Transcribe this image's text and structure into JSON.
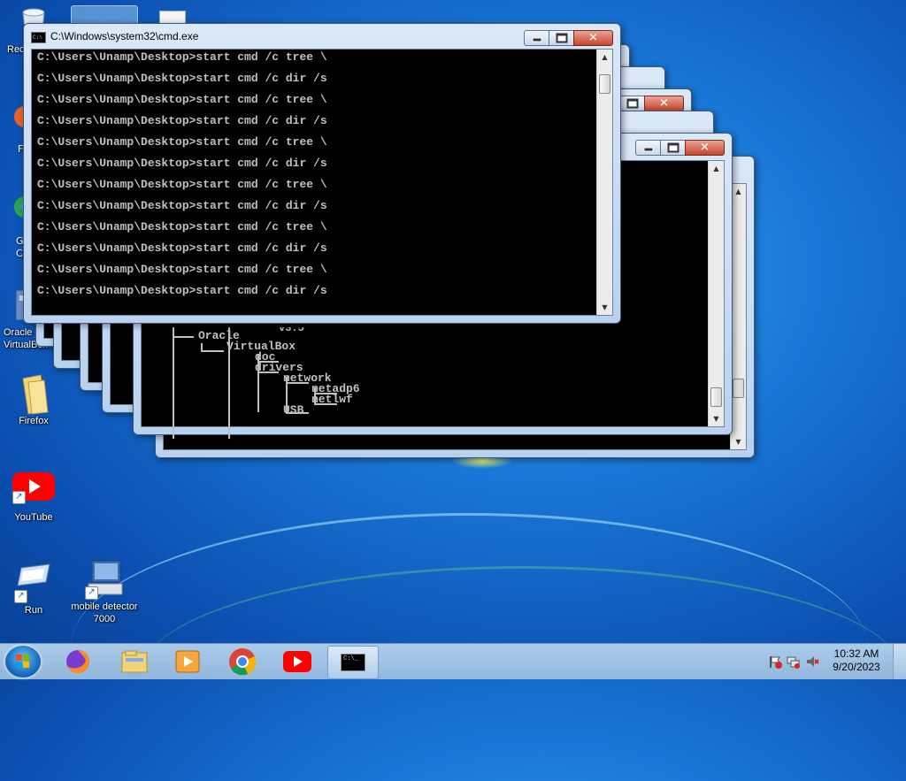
{
  "desktop": {
    "icons": [
      {
        "label": "Rec",
        "name": "recycle-bin"
      },
      {
        "label": "Oracle VirtualBox",
        "name": "virtualbox"
      },
      {
        "label": "Firefox",
        "name": "firefox-folder"
      },
      {
        "label": "YouTube",
        "name": "youtube"
      },
      {
        "label": "Run",
        "name": "run"
      },
      {
        "label": "mobile detector 7000",
        "name": "mobile-detector"
      }
    ],
    "partial_labels": [
      "F",
      "G",
      "C"
    ]
  },
  "front_window": {
    "title": "C:\\Windows\\system32\\cmd.exe",
    "lines": [
      "C:\\Users\\Unamp\\Desktop>start cmd /c tree \\",
      "C:\\Users\\Unamp\\Desktop>start cmd /c dir /s",
      "C:\\Users\\Unamp\\Desktop>start cmd /c tree \\",
      "C:\\Users\\Unamp\\Desktop>start cmd /c dir /s",
      "C:\\Users\\Unamp\\Desktop>start cmd /c tree \\",
      "C:\\Users\\Unamp\\Desktop>start cmd /c dir /s",
      "C:\\Users\\Unamp\\Desktop>start cmd /c tree \\",
      "C:\\Users\\Unamp\\Desktop>start cmd /c dir /s",
      "C:\\Users\\Unamp\\Desktop>start cmd /c tree \\",
      "C:\\Users\\Unamp\\Desktop>start cmd /c dir /s",
      "C:\\Users\\Unamp\\Desktop>start cmd /c tree \\",
      "C:\\Users\\Unamp\\Desktop>start cmd /c dir /s"
    ]
  },
  "tree_window": {
    "partial_top": "v3.5",
    "items": {
      "oracle": "Oracle",
      "virtualbox": "VirtualBox",
      "doc": "doc",
      "drivers": "drivers",
      "network": "network",
      "netadp6": "netadp6",
      "netlwf": "netlwf",
      "usb": "USB"
    }
  },
  "taskbar": {
    "items": [
      "firefox",
      "explorer",
      "media-player",
      "chrome",
      "youtube",
      "cmd"
    ],
    "clock": {
      "time": "10:32 AM",
      "date": "9/20/2023"
    }
  },
  "colors": {
    "console_text": "#c0c0c0",
    "console_bg": "#000000",
    "close_button": "#c7452c"
  }
}
